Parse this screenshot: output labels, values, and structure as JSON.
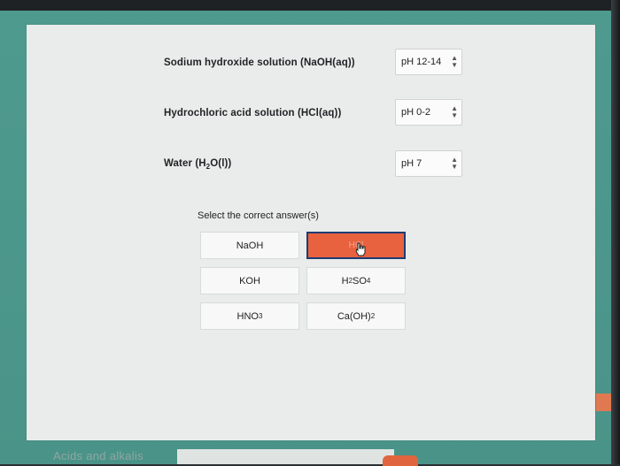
{
  "matching": [
    {
      "label_main": "Sodium hydroxide solution (NaOH(aq))",
      "label_pre": "",
      "label_sub": "",
      "label_post": "",
      "value": "pH 12-14"
    },
    {
      "label_main": "Hydrochloric acid solution (HCl(aq))",
      "label_pre": "",
      "label_sub": "",
      "label_post": "",
      "value": "pH 0-2"
    },
    {
      "label_main": "",
      "label_pre": "Water (H",
      "label_sub": "2",
      "label_post": "O(l))",
      "value": "pH 7"
    }
  ],
  "prompt": "Select the correct answer(s)",
  "answers": [
    {
      "pre": "NaOH",
      "sub": "",
      "post": ""
    },
    {
      "pre": "HCl",
      "sub": "",
      "post": ""
    },
    {
      "pre": "KOH",
      "sub": "",
      "post": ""
    },
    {
      "pre": "H",
      "sub": "2",
      "post": "SO",
      "sub2": "4"
    },
    {
      "pre": "HNO",
      "sub": "3",
      "post": ""
    },
    {
      "pre": "Ca(OH)",
      "sub": "2",
      "post": ""
    }
  ],
  "footer": {
    "section": "Acids and alkalis"
  },
  "colors": {
    "selected_answer": "#e8623f",
    "selected_border": "#1f3b73",
    "background": "#4c978c",
    "panel": "#e9ecea"
  }
}
